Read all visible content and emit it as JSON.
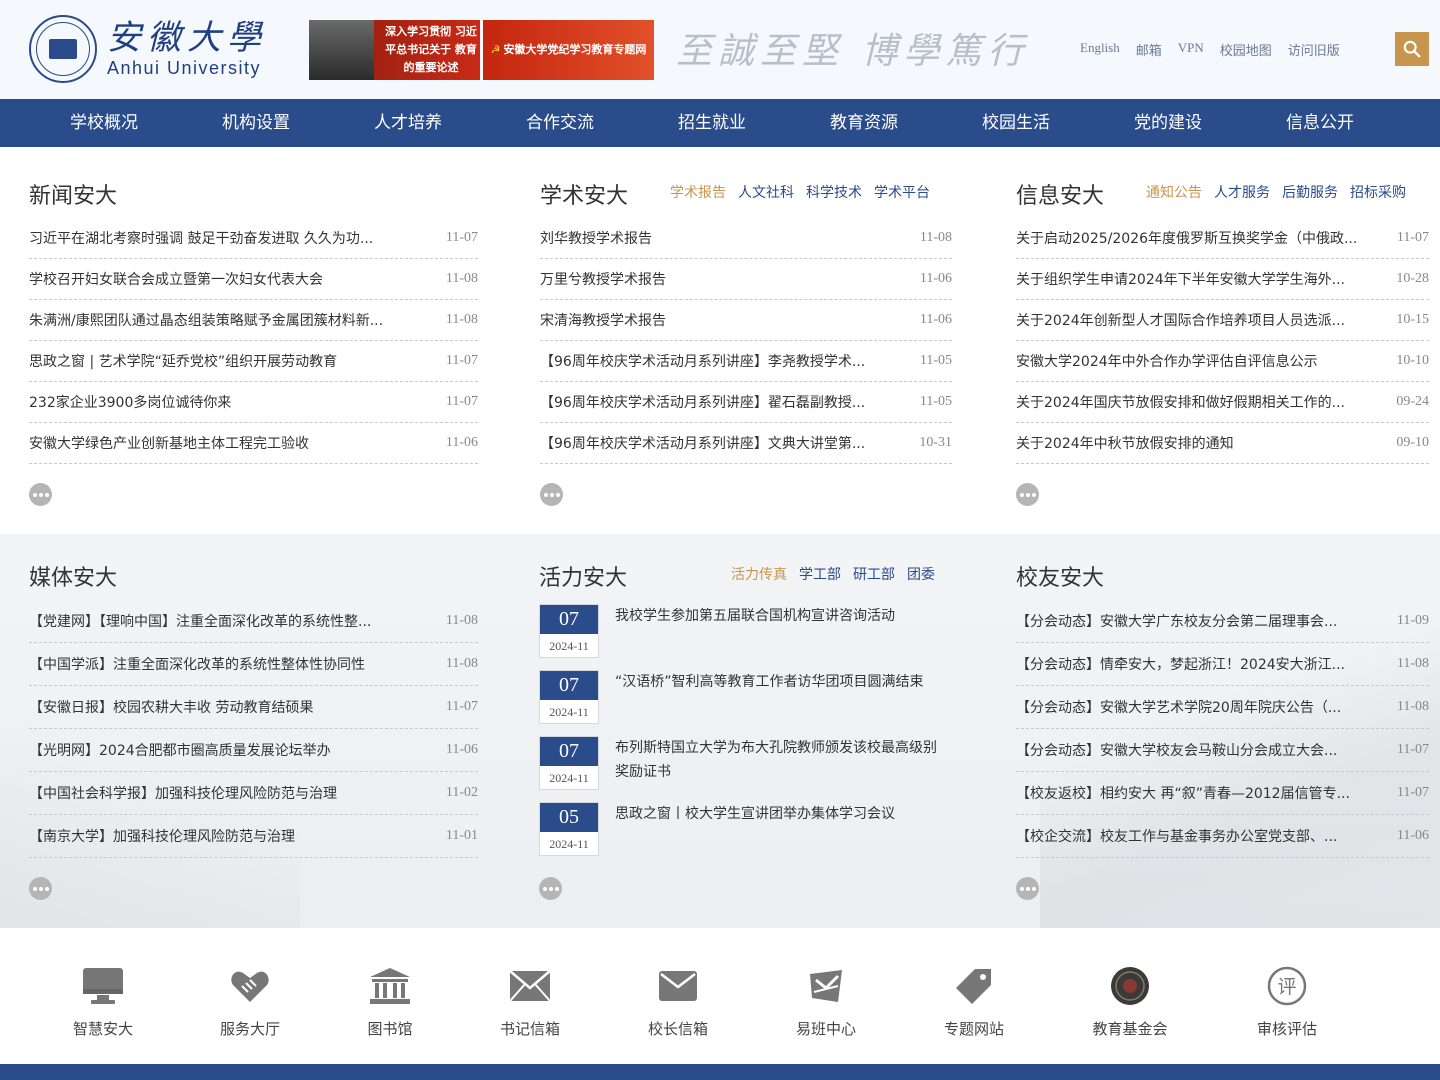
{
  "header": {
    "logo_cn": "安徽大學",
    "logo_en": "Anhui University",
    "banner1_text": "深入学习贯彻 习近平总书记关于 教育的重要论述",
    "banner2_text": "安徽大学党纪学习教育专题网",
    "motto": "至誠至堅 博學篤行",
    "links": [
      "English",
      "邮箱",
      "VPN",
      "校园地图",
      "访问旧版"
    ]
  },
  "nav": [
    "学校概况",
    "机构设置",
    "人才培养",
    "合作交流",
    "招生就业",
    "教育资源",
    "校园生活",
    "党的建设",
    "信息公开"
  ],
  "news": {
    "title": "新闻安大",
    "items": [
      {
        "t": "习近平在湖北考察时强调 鼓足干劲奋发进取 久久为功...",
        "d": "11-07"
      },
      {
        "t": "学校召开妇女联合会成立暨第一次妇女代表大会",
        "d": "11-08"
      },
      {
        "t": "朱满洲/康熙团队通过晶态组装策略赋予金属团簇材料新...",
        "d": "11-08"
      },
      {
        "t": "思政之窗 | 艺术学院“延乔党校”组织开展劳动教育",
        "d": "11-07"
      },
      {
        "t": "232家企业3900多岗位诚待你来",
        "d": "11-07"
      },
      {
        "t": "安徽大学绿色产业创新基地主体工程完工验收",
        "d": "11-06"
      }
    ]
  },
  "academic": {
    "title": "学术安大",
    "tabs": [
      "学术报告",
      "人文社科",
      "科学技术",
      "学术平台"
    ],
    "items": [
      {
        "t": "刘华教授学术报告",
        "d": "11-08"
      },
      {
        "t": "万里兮教授学术报告",
        "d": "11-06"
      },
      {
        "t": "宋清海教授学术报告",
        "d": "11-06"
      },
      {
        "t": "【96周年校庆学术活动月系列讲座】李尧教授学术...",
        "d": "11-05"
      },
      {
        "t": "【96周年校庆学术活动月系列讲座】翟石磊副教授...",
        "d": "11-05"
      },
      {
        "t": "【96周年校庆学术活动月系列讲座】文典大讲堂第...",
        "d": "10-31"
      }
    ]
  },
  "info": {
    "title": "信息安大",
    "tabs": [
      "通知公告",
      "人才服务",
      "后勤服务",
      "招标采购"
    ],
    "items": [
      {
        "t": "关于启动2025/2026年度俄罗斯互换奖学金（中俄政...",
        "d": "11-07"
      },
      {
        "t": "关于组织学生申请2024年下半年安徽大学学生海外...",
        "d": "10-28"
      },
      {
        "t": "关于2024年创新型人才国际合作培养项目人员选派...",
        "d": "10-15"
      },
      {
        "t": "安徽大学2024年中外合作办学评估自评信息公示",
        "d": "10-10"
      },
      {
        "t": "关于2024年国庆节放假安排和做好假期相关工作的...",
        "d": "09-24"
      },
      {
        "t": "关于2024年中秋节放假安排的通知",
        "d": "09-10"
      }
    ]
  },
  "media": {
    "title": "媒体安大",
    "items": [
      {
        "t": "【党建网】【理响中国】注重全面深化改革的系统性整...",
        "d": "11-08"
      },
      {
        "t": "【中国学派】注重全面深化改革的系统性整体性协同性",
        "d": "11-08"
      },
      {
        "t": "【安徽日报】校园农耕大丰收 劳动教育结硕果",
        "d": "11-07"
      },
      {
        "t": "【光明网】2024合肥都市圈高质量发展论坛举办",
        "d": "11-06"
      },
      {
        "t": "【中国社会科学报】加强科技伦理风险防范与治理",
        "d": "11-02"
      },
      {
        "t": "【南京大学】加强科技伦理风险防范与治理",
        "d": "11-01"
      }
    ]
  },
  "vitality": {
    "title": "活力安大",
    "tabs": [
      "活力传真",
      "学工部",
      "研工部",
      "团委"
    ],
    "items": [
      {
        "day": "07",
        "ym": "2024-11",
        "t": "我校学生参加第五届联合国机构宣讲咨询活动"
      },
      {
        "day": "07",
        "ym": "2024-11",
        "t": "“汉语桥”智利高等教育工作者访华团项目圆满结束"
      },
      {
        "day": "07",
        "ym": "2024-11",
        "t": "布列斯特国立大学为布大孔院教师颁发该校最高级别 奖励证书"
      },
      {
        "day": "05",
        "ym": "2024-11",
        "t": "思政之窗丨校大学生宣讲团举办集体学习会议"
      }
    ]
  },
  "alumni": {
    "title": "校友安大",
    "items": [
      {
        "t": "【分会动态】安徽大学广东校友分会第二届理事会...",
        "d": "11-09"
      },
      {
        "t": "【分会动态】情牵安大，梦起浙江！2024安大浙江...",
        "d": "11-08"
      },
      {
        "t": "【分会动态】安徽大学艺术学院20周年院庆公告（...",
        "d": "11-08"
      },
      {
        "t": "【分会动态】安徽大学校友会马鞍山分会成立大会...",
        "d": "11-07"
      },
      {
        "t": "【校友返校】相约安大 再“叙”青春—2012届信管专...",
        "d": "11-07"
      },
      {
        "t": "【校企交流】校友工作与基金事务办公室党支部、...",
        "d": "11-06"
      }
    ]
  },
  "quick": [
    "智慧安大",
    "服务大厅",
    "图书馆",
    "书记信箱",
    "校长信箱",
    "易班中心",
    "专题网站",
    "教育基金会",
    "审核评估"
  ],
  "colors": {
    "primary": "#2a4c8b",
    "accent": "#c8954e"
  }
}
